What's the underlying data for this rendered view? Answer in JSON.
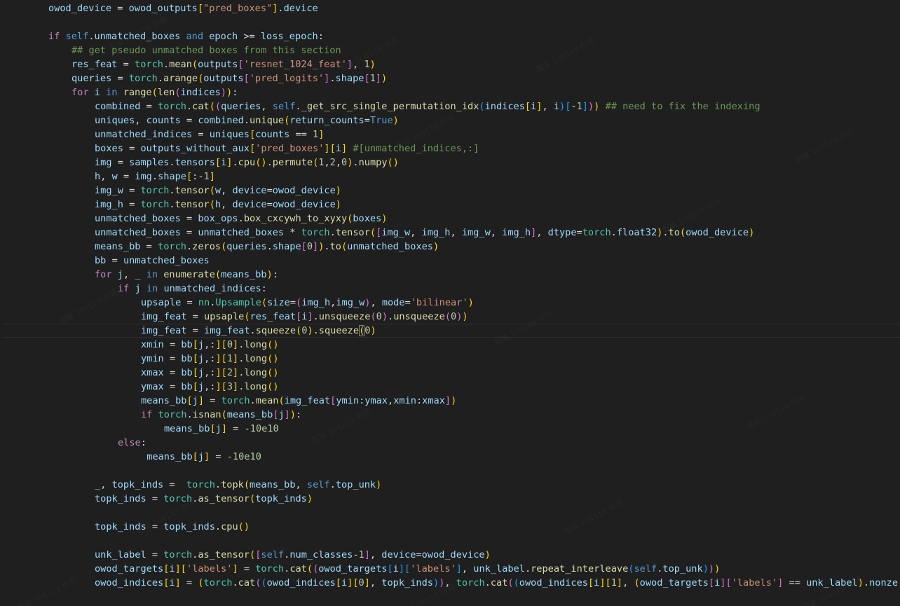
{
  "editor": {
    "theme_colors": {
      "background": "#1f1f1f",
      "keyword": "#569cd6",
      "control": "#c586c0",
      "variable": "#9cdcfe",
      "function": "#dcdcaa",
      "class": "#4ec9b0",
      "string": "#ce9178",
      "number": "#b5cea8",
      "comment": "#6a9955"
    },
    "lines": [
      {
        "indent": 0,
        "text": "owod_device = owod_outputs[\"pred_boxes\"].device"
      },
      {
        "indent": 0,
        "text": ""
      },
      {
        "indent": 0,
        "text": "if self.unmatched_boxes and epoch >= loss_epoch:"
      },
      {
        "indent": 1,
        "text": "## get pseudo unmatched boxes from this section"
      },
      {
        "indent": 1,
        "text": "res_feat = torch.mean(outputs['resnet_1024_feat'], 1)"
      },
      {
        "indent": 1,
        "text": "queries = torch.arange(outputs['pred_logits'].shape[1])"
      },
      {
        "indent": 1,
        "text": "for i in range(len(indices)):"
      },
      {
        "indent": 2,
        "text": "combined = torch.cat((queries, self._get_src_single_permutation_idx(indices[i], i)[-1])) ## need to fix the indexing"
      },
      {
        "indent": 2,
        "text": "uniques, counts = combined.unique(return_counts=True)"
      },
      {
        "indent": 2,
        "text": "unmatched_indices = uniques[counts == 1]"
      },
      {
        "indent": 2,
        "text": "boxes = outputs_without_aux['pred_boxes'][i] #[unmatched_indices,:]"
      },
      {
        "indent": 2,
        "text": "img = samples.tensors[i].cpu().permute(1,2,0).numpy()"
      },
      {
        "indent": 2,
        "text": "h, w = img.shape[:-1]"
      },
      {
        "indent": 2,
        "text": "img_w = torch.tensor(w, device=owod_device)"
      },
      {
        "indent": 2,
        "text": "img_h = torch.tensor(h, device=owod_device)"
      },
      {
        "indent": 2,
        "text": "unmatched_boxes = box_ops.box_cxcywh_to_xyxy(boxes)"
      },
      {
        "indent": 2,
        "text": "unmatched_boxes = unmatched_boxes * torch.tensor([img_w, img_h, img_w, img_h], dtype=torch.float32).to(owod_device)"
      },
      {
        "indent": 2,
        "text": "means_bb = torch.zeros(queries.shape[0]).to(unmatched_boxes)"
      },
      {
        "indent": 2,
        "text": "bb = unmatched_boxes"
      },
      {
        "indent": 2,
        "text": "for j, _ in enumerate(means_bb):"
      },
      {
        "indent": 3,
        "text": "if j in unmatched_indices:"
      },
      {
        "indent": 4,
        "text": "upsaple = nn.Upsample(size=(img_h,img_w), mode='bilinear')"
      },
      {
        "indent": 4,
        "text": "img_feat = upsaple(res_feat[i].unsqueeze(0).unsqueeze(0))"
      },
      {
        "indent": 4,
        "text": "img_feat = img_feat.squeeze(0).squeeze(0)"
      },
      {
        "indent": 4,
        "text": "xmin = bb[j,:][0].long()"
      },
      {
        "indent": 4,
        "text": "ymin = bb[j,:][1].long()"
      },
      {
        "indent": 4,
        "text": "xmax = bb[j,:][2].long()"
      },
      {
        "indent": 4,
        "text": "ymax = bb[j,:][3].long()"
      },
      {
        "indent": 4,
        "text": "means_bb[j] = torch.mean(img_feat[ymin:ymax,xmin:xmax])"
      },
      {
        "indent": 4,
        "text": "if torch.isnan(means_bb[j]):"
      },
      {
        "indent": 5,
        "text": "means_bb[j] = -10e10"
      },
      {
        "indent": 3,
        "text": "else:"
      },
      {
        "indent": 4,
        "text": " means_bb[j] = -10e10"
      },
      {
        "indent": 0,
        "text": ""
      },
      {
        "indent": 2,
        "text": "_, topk_inds =  torch.topk(means_bb, self.top_unk)"
      },
      {
        "indent": 2,
        "text": "topk_inds = torch.as_tensor(topk_inds)"
      },
      {
        "indent": 0,
        "text": ""
      },
      {
        "indent": 2,
        "text": "topk_inds = topk_inds.cpu()"
      },
      {
        "indent": 0,
        "text": ""
      },
      {
        "indent": 2,
        "text": "unk_label = torch.as_tensor([self.num_classes-1], device=owod_device)"
      },
      {
        "indent": 2,
        "text": "owod_targets[i]['labels'] = torch.cat((owod_targets[i]['labels'], unk_label.repeat_interleave(self.top_unk)))"
      },
      {
        "indent": 2,
        "text": "owod_indices[i] = (torch.cat((owod_indices[i][0], topk_inds)), torch.cat((owod_indices[i][1], (owod_targets[i]['labels'] == unk_label).nonze"
      }
    ],
    "current_line_index": 23,
    "cursor_column": 39,
    "watermark_text": "周某 104119 样用"
  }
}
